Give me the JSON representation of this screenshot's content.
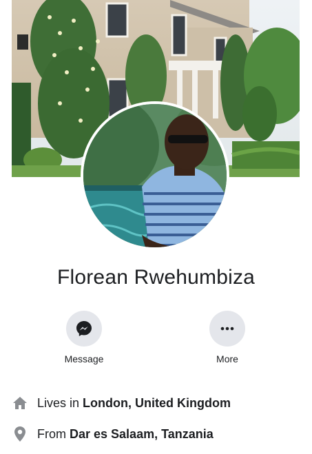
{
  "profile": {
    "name": "Florean Rwehumbiza"
  },
  "actions": {
    "message_label": "Message",
    "more_label": "More"
  },
  "info": {
    "lives_prefix": "Lives in",
    "lives_value": "London, United Kingdom",
    "from_prefix": "From",
    "from_value": "Dar es Salaam, Tanzania"
  },
  "icons": {
    "message": "messenger-icon",
    "more": "more-dots-icon",
    "lives": "home-icon",
    "from": "location-pin-icon"
  },
  "colors": {
    "button_bg": "#e4e6eb",
    "text": "#1c1e21",
    "icon_gray": "#8a8d91"
  }
}
